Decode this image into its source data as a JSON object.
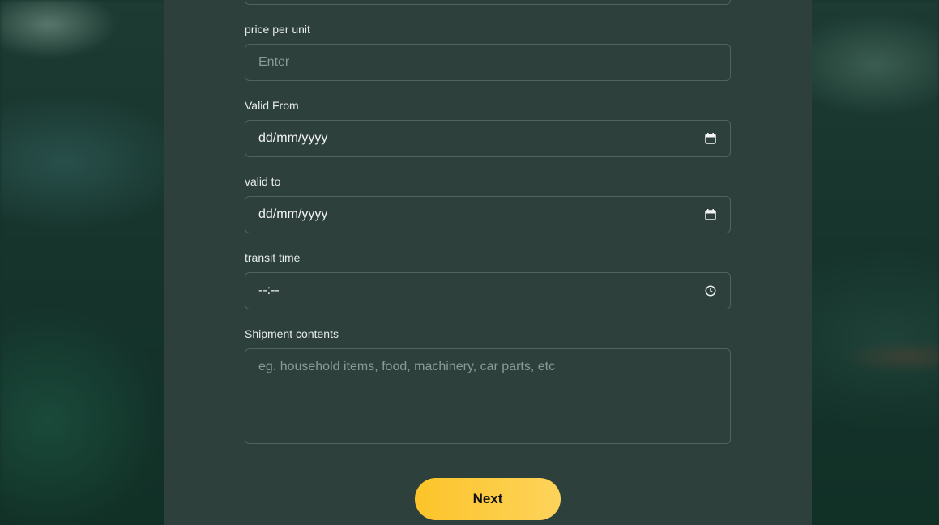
{
  "form": {
    "price": {
      "label": "price per unit",
      "placeholder": "Enter",
      "value": ""
    },
    "valid_from": {
      "label": "Valid From",
      "value": "dd/mm/yyyy"
    },
    "valid_to": {
      "label": "valid to",
      "value": "dd/mm/yyyy"
    },
    "transit_time": {
      "label": "transit time",
      "value": "--:--"
    },
    "shipment": {
      "label": "Shipment contents",
      "placeholder": "eg. household items, food, machinery, car parts, etc",
      "value": ""
    },
    "next_label": "Next"
  },
  "colors": {
    "panel": "#2e403c",
    "field_border": "#52635f",
    "button": "#fcc429"
  },
  "icons": {
    "date_picker": "calendar-icon",
    "time_picker": "clock-icon"
  }
}
